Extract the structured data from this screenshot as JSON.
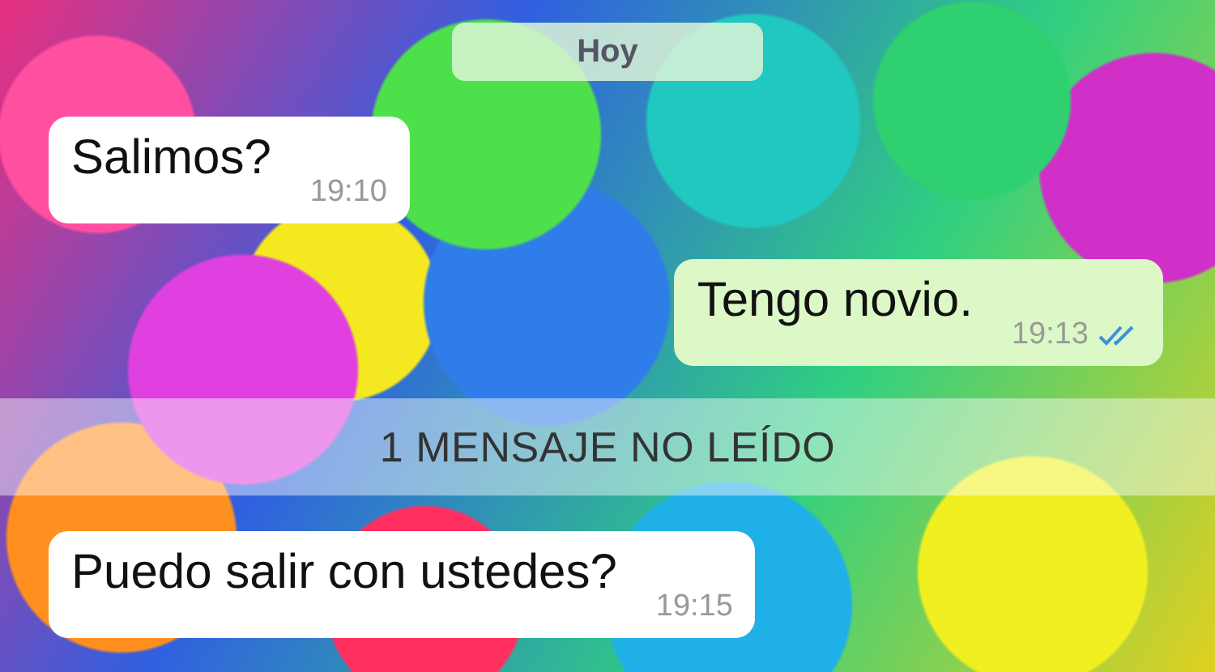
{
  "chat": [
    {
      "kind": "date",
      "text": "Hoy"
    },
    {
      "kind": "incoming",
      "text": "Salimos?",
      "time": "19:10"
    },
    {
      "kind": "outgoing",
      "text": "Tengo novio.",
      "time": "19:13",
      "read": true
    },
    {
      "kind": "unread",
      "text": "1 MENSAJE NO LEÍDO"
    },
    {
      "kind": "incoming",
      "text": "Puedo salir con ustedes?",
      "time": "19:15"
    }
  ]
}
